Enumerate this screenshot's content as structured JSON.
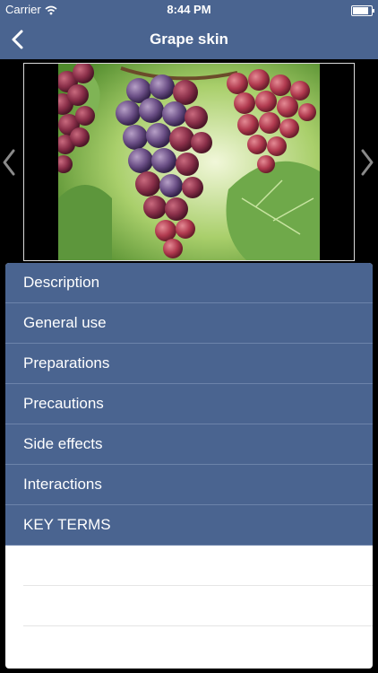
{
  "status": {
    "carrier": "Carrier",
    "time": "8:44 PM",
    "battery_level": 0.95
  },
  "nav": {
    "title": "Grape skin",
    "back_icon": "chevron-left-icon"
  },
  "gallery": {
    "image": "grape-cluster-photo",
    "prev_icon": "chevron-left-icon",
    "next_icon": "chevron-right-icon"
  },
  "menu": {
    "items": [
      {
        "label": "Description"
      },
      {
        "label": "General use"
      },
      {
        "label": "Preparations"
      },
      {
        "label": "Precautions"
      },
      {
        "label": "Side effects"
      },
      {
        "label": "Interactions"
      },
      {
        "label": "KEY TERMS"
      }
    ]
  },
  "colors": {
    "accent": "#4a6490",
    "separator": "#6c83aa",
    "background": "#000000"
  }
}
